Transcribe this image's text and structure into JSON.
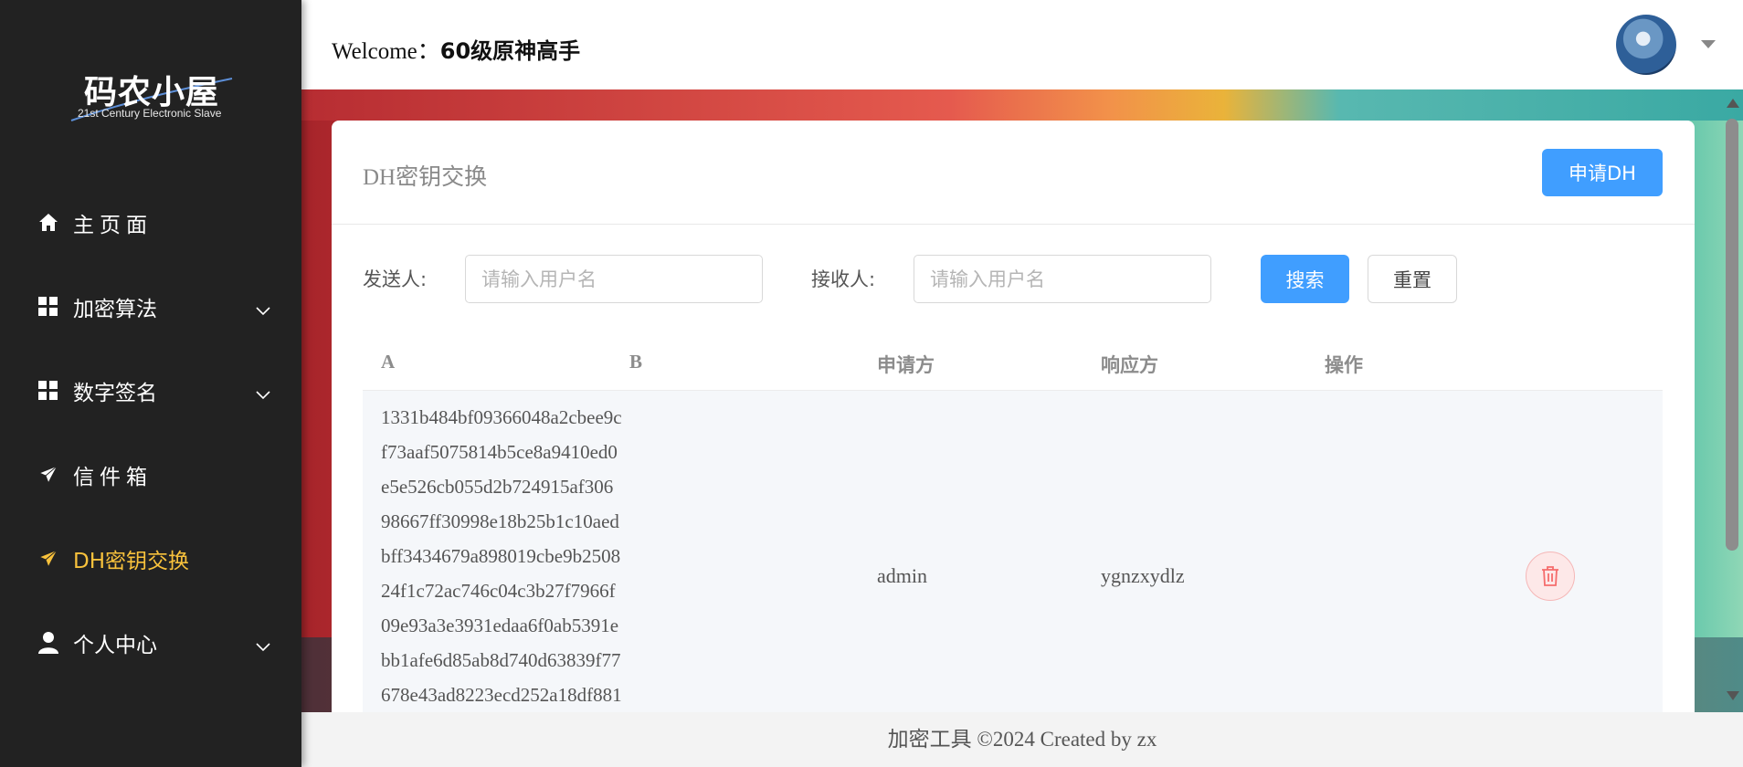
{
  "sidebar": {
    "logo": {
      "title": "码农小屋",
      "subtitle": "21st Century Electronic Slave"
    },
    "items": [
      {
        "label": "主页面",
        "icon": "home-icon"
      },
      {
        "label": "加密算法",
        "icon": "grid-icon"
      },
      {
        "label": "数字签名",
        "icon": "grid-icon"
      },
      {
        "label": "信件箱",
        "icon": "paper-plane-icon"
      },
      {
        "label": "DH密钥交换",
        "icon": "paper-plane-icon",
        "active": true
      },
      {
        "label": "个人中心",
        "icon": "user-icon"
      }
    ]
  },
  "header": {
    "welcome_prefix": "Welcome：",
    "username": "60级原神高手"
  },
  "card": {
    "title": "DH密钥交换",
    "apply_button": "申请DH"
  },
  "filters": {
    "sender_label": "发送人:",
    "sender_placeholder": "请输入用户名",
    "receiver_label": "接收人:",
    "receiver_placeholder": "请输入用户名",
    "search_button": "搜索",
    "reset_button": "重置"
  },
  "table": {
    "columns": [
      "A",
      "B",
      "申请方",
      "响应方",
      "操作"
    ],
    "rows": [
      {
        "a_lines": [
          "1331b484bf09366048a2cbee9c",
          "f73aaf5075814b5ce8a9410ed0",
          "e5e526cb055d2b724915af306",
          "98667ff30998e18b25b1c10aed",
          "bff3434679a898019cbe9b2508",
          "24f1c72ac746c04c3b27f7966f",
          "09e93a3e3931edaa6f0ab5391e",
          "bb1afe6d85ab8d740d63839f77",
          "678e43ad8223ecd252a18df881"
        ],
        "b": "",
        "requester": "admin",
        "responder": "ygnzxydlz"
      }
    ]
  },
  "footer": {
    "text": "加密工具 ©2024 Created by zx"
  },
  "colors": {
    "accent": "#409eff",
    "active_nav": "#f9c23c",
    "sidebar_bg": "#222222",
    "danger": "#f56c6c"
  }
}
